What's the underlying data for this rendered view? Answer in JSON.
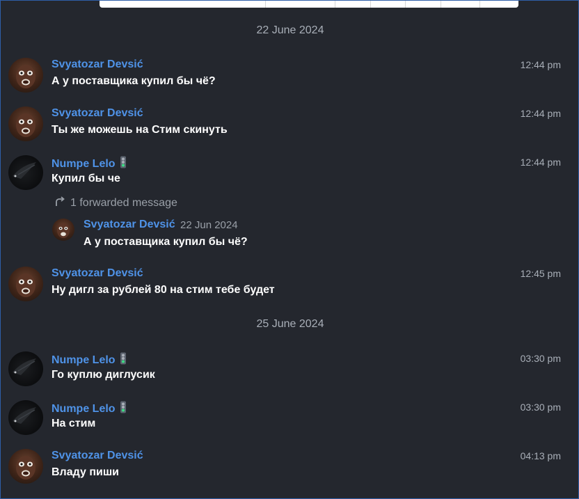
{
  "dates": [
    "22 June 2024",
    "25 June 2024"
  ],
  "messages": [
    {
      "author": "Svyatozar Devsić",
      "time": "12:44 pm",
      "text": "А у поставщика купил бы чё?",
      "avatar": "svyatozar-avatar"
    },
    {
      "author": "Svyatozar Devsić",
      "time": "12:44 pm",
      "text": "Ты же можешь на Стим скинуть",
      "avatar": "svyatozar-avatar"
    },
    {
      "author": "Numpe Lelo",
      "time": "12:44 pm",
      "text": "Купил бы че",
      "avatar": "numpe-avatar",
      "badge": "traffic-light-icon",
      "forwarded": {
        "label": "1 forwarded message",
        "author": "Svyatozar Devsić",
        "date": "22 Jun 2024",
        "text": "А у поставщика купил бы чё?"
      }
    },
    {
      "author": "Svyatozar Devsić",
      "time": "12:45 pm",
      "text": "Ну дигл за рублей 80 на стим тебе будет",
      "avatar": "svyatozar-avatar"
    },
    {
      "author": "Numpe Lelo",
      "time": "03:30 pm",
      "text": "Го куплю диглусик",
      "avatar": "numpe-avatar",
      "badge": "traffic-light-icon"
    },
    {
      "author": "Numpe Lelo",
      "time": "03:30 pm",
      "text": "На стим",
      "avatar": "numpe-avatar",
      "badge": "traffic-light-icon"
    },
    {
      "author": "Svyatozar Devsić",
      "time": "04:13 pm",
      "text": "Владу пиши",
      "avatar": "svyatozar-avatar"
    }
  ],
  "colors": {
    "background": "#24272e",
    "author": "#4f93e8",
    "text": "#ffffff",
    "muted": "#a9afb8"
  }
}
